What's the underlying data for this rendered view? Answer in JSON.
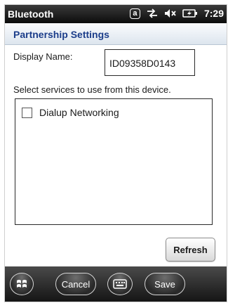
{
  "statusbar": {
    "title": "Bluetooth",
    "clock": "7:29",
    "icons": [
      "at-icon",
      "connectivity-arrows-icon",
      "speaker-muted-icon",
      "battery-charging-icon"
    ]
  },
  "header": {
    "title": "Partnership Settings"
  },
  "form": {
    "display_name_label": "Display Name:",
    "display_name_value": "ID09358D0143",
    "services_label": "Select services to use from this device.",
    "services": [
      {
        "label": "Dialup Networking",
        "checked": false
      }
    ]
  },
  "buttons": {
    "refresh": "Refresh"
  },
  "softkeys": {
    "cancel": "Cancel",
    "save": "Save",
    "left_icon": "windows-start-icon",
    "middle_icon": "keyboard-icon"
  },
  "colors": {
    "header_title": "#1b3d8a",
    "statusbar_bg": "#0c0c0c",
    "softbar_bg": "#151515"
  }
}
